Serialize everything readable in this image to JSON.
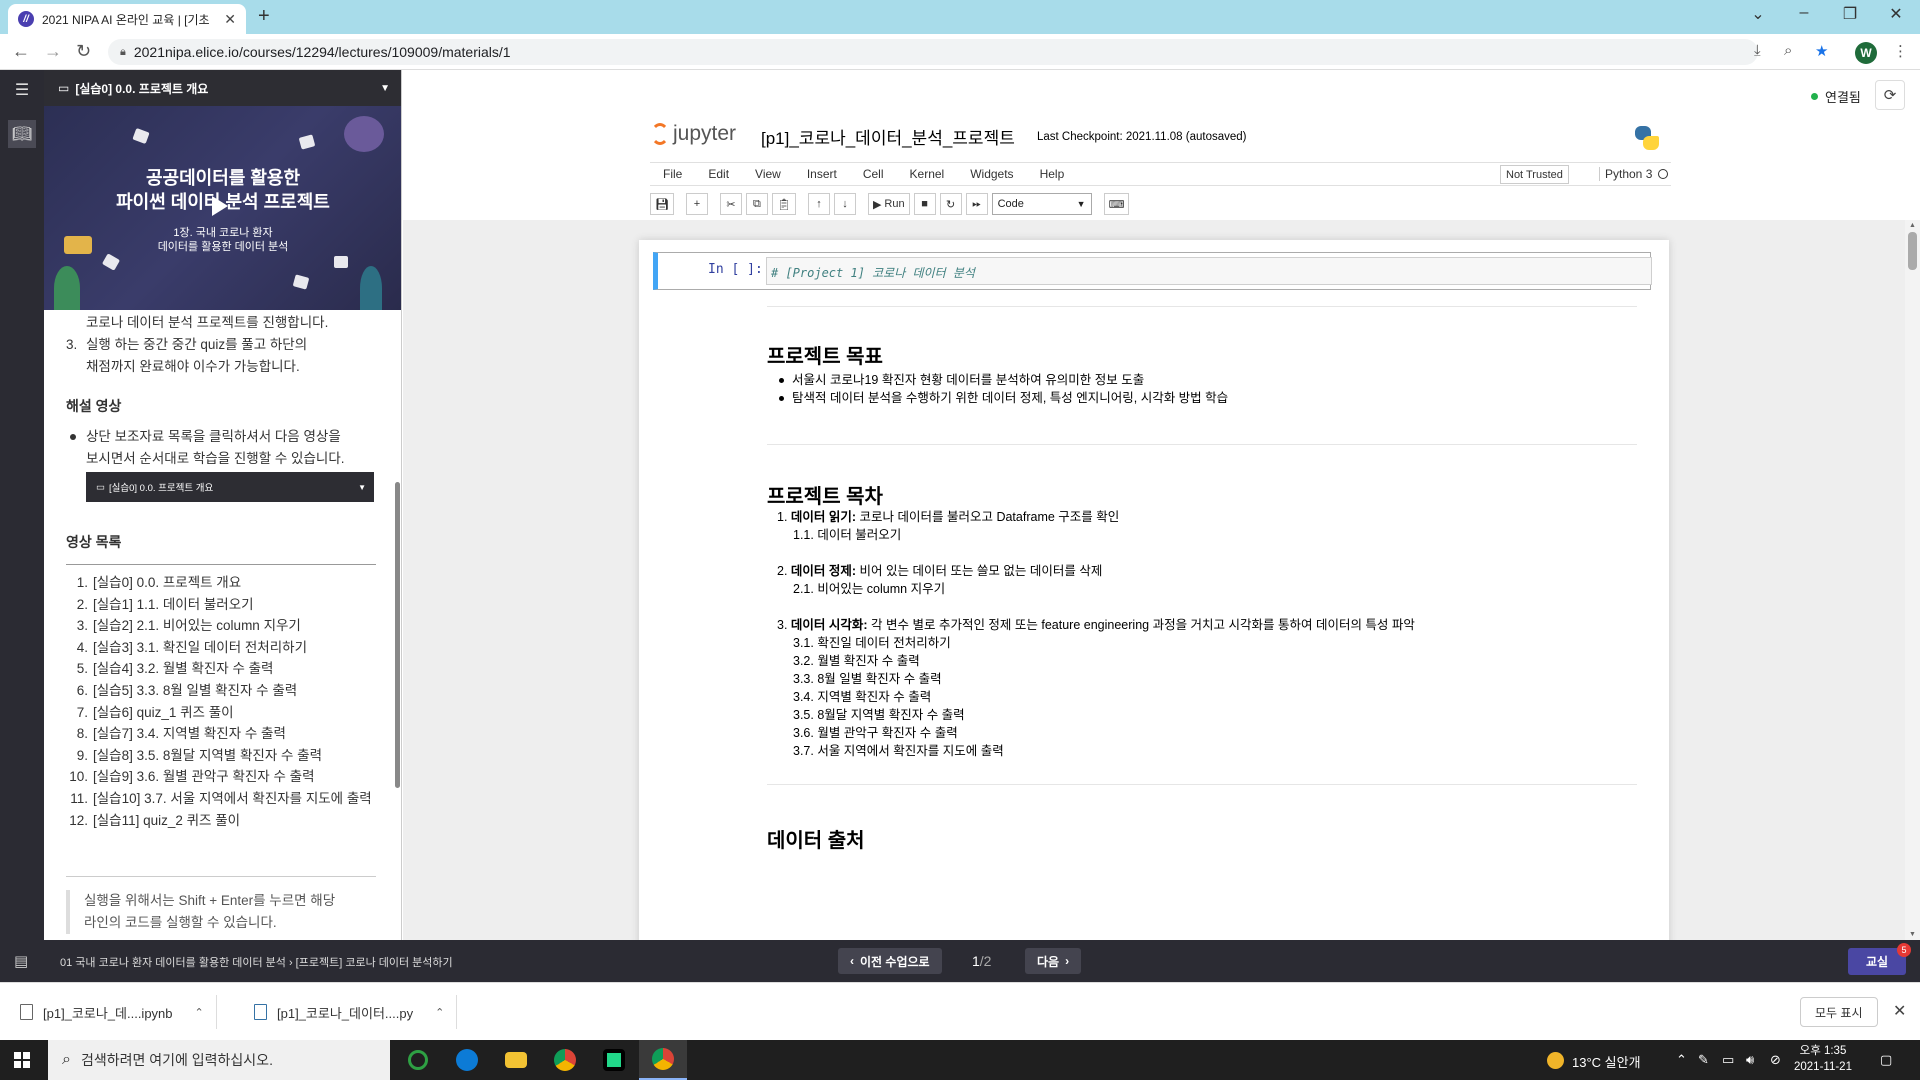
{
  "browser": {
    "tab_title": "2021 NIPA AI 온라인 교육 | [기초",
    "url": "2021nipa.elice.io/courses/12294/lectures/109009/materials/1",
    "profile_initial": "W"
  },
  "left_panel": {
    "video_header": "[실습0] 0.0. 프로젝트 개요",
    "video": {
      "title_line1": "공공데이터를 활용한",
      "title_line2": "파이썬 데이터 분석 프로젝트",
      "subtitle_line1": "1장. 국내 코로나 환자",
      "subtitle_line2": "데이터를 활용한 데이터 분석"
    },
    "intro_line1": "코로나 데이터 분석 프로젝트를 진행합니다.",
    "intro_item3_a": "실행 하는 중간 중간 quiz를 풀고 하단의",
    "intro_item3_b": "채점까지 완료해야 이수가 가능합니다.",
    "intro_item3_num": "3.",
    "section_video_heading": "해설 영상",
    "video_bullet_a": "상단 보조자료 목록을 클릭하셔서 다음 영상을",
    "video_bullet_b": "보시면서 순서대로 학습을 진행할 수 있습니다.",
    "mini_player_label": "[실습0] 0.0. 프로젝트 개요",
    "video_list_heading": "영상 목록",
    "video_list": [
      {
        "num": "1.",
        "label": "[실습0] 0.0. 프로젝트 개요"
      },
      {
        "num": "2.",
        "label": "[실습1] 1.1. 데이터 불러오기"
      },
      {
        "num": "3.",
        "label": "[실습2] 2.1. 비어있는 column 지우기"
      },
      {
        "num": "4.",
        "label": "[실습3] 3.1. 확진일 데이터 전처리하기"
      },
      {
        "num": "5.",
        "label": "[실습4] 3.2. 월별 확진자 수 출력"
      },
      {
        "num": "6.",
        "label": "[실습5] 3.3. 8월 일별 확진자 수 출력"
      },
      {
        "num": "7.",
        "label": "[실습6] quiz_1 퀴즈 풀이"
      },
      {
        "num": "8.",
        "label": "[실습7] 3.4. 지역별 확진자 수 출력"
      },
      {
        "num": "9.",
        "label": "[실습8] 3.5. 8월달 지역별 확진자 수 출력"
      },
      {
        "num": "10.",
        "label": "[실습9] 3.6. 월별 관악구 확진자 수 출력"
      },
      {
        "num": "11.",
        "label": "[실습10] 3.7. 서울 지역에서 확진자를 지도에 출력"
      },
      {
        "num": "12.",
        "label": "[실습11] quiz_2 퀴즈 풀이"
      }
    ],
    "tip_line1": "실행을 위해서는 Shift + Enter를 누르면 해당",
    "tip_line2": "라인의 코드를 실행할 수 있습니다."
  },
  "jupyter": {
    "status": "연결됨",
    "logo_text": "jupyter",
    "notebook_title": "[p1]_코로나_데이터_분석_프로젝트",
    "checkpoint": "Last Checkpoint: 2021.11.08  (autosaved)",
    "menu": [
      "File",
      "Edit",
      "View",
      "Insert",
      "Cell",
      "Kernel",
      "Widgets",
      "Help"
    ],
    "trusted": "Not Trusted",
    "kernel": "Python 3",
    "run_label": "Run",
    "cell_type": "Code",
    "cell_prompt": "In [ ]:",
    "cell_code": "# [Project 1] 코로나 데이터 분석"
  },
  "notebook": {
    "goal_heading": "프로젝트 목표",
    "goal_items": [
      "서울시 코로나19 확진자 현황 데이터를 분석하여 유의미한 정보 도출",
      "탐색적 데이터 분석을 수행하기 위한 데이터 정제, 특성 엔지니어링, 시각화 방법 학습"
    ],
    "toc_heading": "프로젝트 목차",
    "toc": {
      "s1_num": "1.",
      "s1_bold": "데이터 읽기:",
      "s1_text": " 코로나 데이터를 불러오고 Dataframe 구조를 확인",
      "s1_sub": [
        "1.1. 데이터 불러오기"
      ],
      "s2_num": "2.",
      "s2_bold": "데이터 정제:",
      "s2_text": " 비어 있는 데이터 또는 쓸모 없는 데이터를 삭제",
      "s2_sub": [
        "2.1. 비어있는 column 지우기"
      ],
      "s3_num": "3.",
      "s3_bold": "데이터 시각화:",
      "s3_text": " 각 변수 별로 추가적인 정제 또는 feature engineering 과정을 거치고 시각화를 통하여 데이터의 특성 파악",
      "s3_sub": [
        "3.1. 확진일 데이터 전처리하기",
        "3.2. 월별 확진자 수 출력",
        "3.3. 8월 일별 확진자 수 출력",
        "3.4. 지역별 확진자 수 출력",
        "3.5. 8월달 지역별 확진자 수 출력",
        "3.6. 월별 관악구 확진자 수 출력",
        "3.7. 서울 지역에서 확진자를 지도에 출력"
      ]
    },
    "next_heading": "데이터 출처"
  },
  "course_bar": {
    "breadcrumb": "01 국내 코로나 환자 데이터를 활용한 데이터 분석  ›  [프로젝트] 코로나 데이터 분석하기",
    "prev": "이전 수업으로",
    "page_current": "1",
    "page_total": "/2",
    "next": "다음",
    "right_button": "교실",
    "badge": "5"
  },
  "downloads": {
    "file1": "[p1]_코로나_데....ipynb",
    "file2": "[p1]_코로나_데이터....py",
    "show_all": "모두 표시"
  },
  "taskbar": {
    "search_placeholder": "검색하려면 여기에 입력하십시오.",
    "weather": "13°C  실안개",
    "time_line1": "오후 1:35",
    "time_line2": "2021-11-21"
  }
}
